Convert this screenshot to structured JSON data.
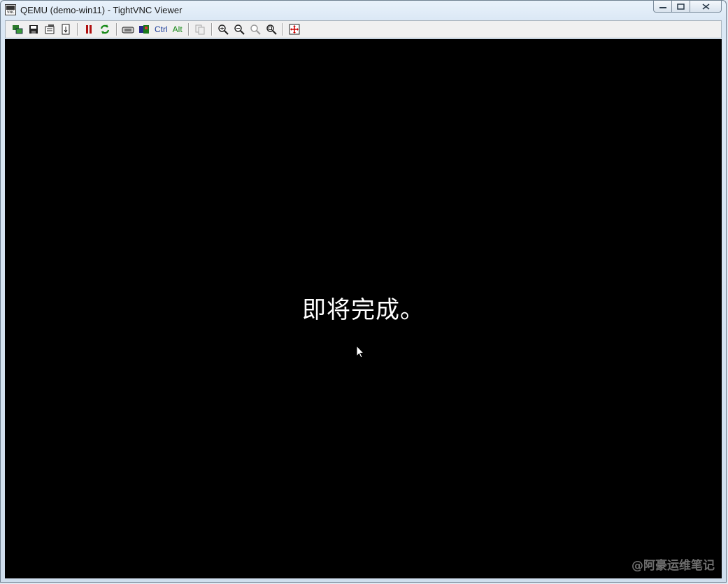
{
  "window": {
    "title": "QEMU (demo-win11) - TightVNC Viewer",
    "app_icon": "vnc-icon"
  },
  "toolbar": {
    "items": [
      {
        "name": "new-connection-icon"
      },
      {
        "name": "save-icon"
      },
      {
        "name": "options-icon"
      },
      {
        "name": "connection-info-icon"
      },
      {
        "name": "pause-icon"
      },
      {
        "name": "refresh-icon"
      },
      {
        "name": "send-ctrl-alt-del-icon"
      },
      {
        "name": "send-ctrl-esc-icon"
      },
      {
        "name": "ctrl-toggle",
        "label": "Ctrl"
      },
      {
        "name": "alt-toggle",
        "label": "Alt"
      },
      {
        "name": "copy-clipboard-icon"
      },
      {
        "name": "zoom-in-icon"
      },
      {
        "name": "zoom-out-icon"
      },
      {
        "name": "zoom-100-icon"
      },
      {
        "name": "zoom-auto-icon"
      },
      {
        "name": "fullscreen-icon"
      }
    ],
    "ctrl_label": "Ctrl",
    "alt_label": "Alt"
  },
  "screen": {
    "message": "即将完成。",
    "watermark": "@阿豪运维笔记"
  },
  "colors": {
    "viewport_bg": "#000000",
    "message_color": "#ffffff",
    "alt_color": "#1a8a1a",
    "ctrl_color": "#1f3f9a"
  }
}
